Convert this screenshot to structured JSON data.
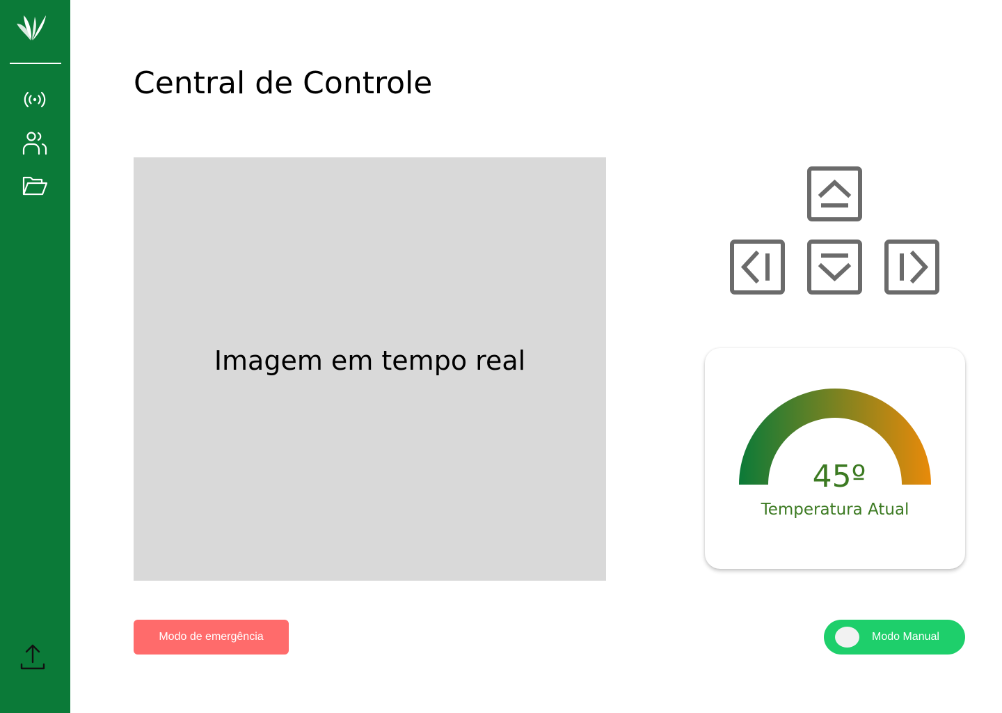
{
  "page": {
    "title": "Central de Controle"
  },
  "sidebar": {
    "logo": "leaf-logo",
    "items": [
      {
        "icon": "signal-broadcast-icon"
      },
      {
        "icon": "users-icon"
      },
      {
        "icon": "folder-open-icon"
      }
    ],
    "footer_icon": "upload-icon"
  },
  "live_view": {
    "label": "Imagem em tempo real"
  },
  "dpad": {
    "buttons": [
      {
        "direction": "up",
        "icon": "arrow-up-box-icon"
      },
      {
        "direction": "left",
        "icon": "arrow-left-box-icon"
      },
      {
        "direction": "down",
        "icon": "arrow-down-box-icon"
      },
      {
        "direction": "right",
        "icon": "arrow-right-box-icon"
      }
    ],
    "color": "#6b6b6b"
  },
  "temperature": {
    "value": "45º",
    "label": "Temperatura Atual",
    "gauge_gradient": [
      "#0b7a38",
      "#e88a0a"
    ],
    "text_color": "#3c7a22"
  },
  "actions": {
    "emergency_label": "Modo de emergência",
    "manual_label": "Modo Manual"
  },
  "colors": {
    "sidebar": "#0b7a38",
    "emergency": "#ff6b6b",
    "toggle": "#1ecf6b",
    "image_placeholder": "#d9d9d9"
  }
}
